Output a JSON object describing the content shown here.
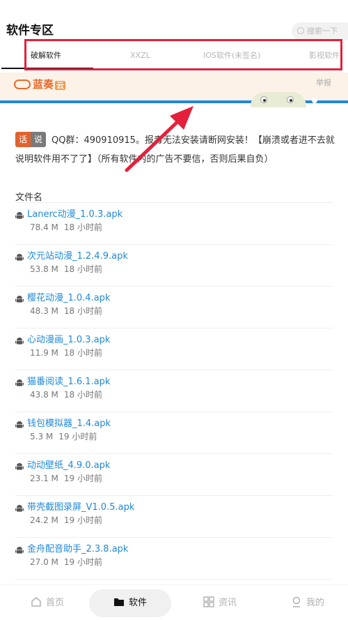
{
  "header": {
    "title": "软件专区",
    "search_placeholder": "搜索一下"
  },
  "tabs": [
    {
      "label": "破解软件",
      "active": true
    },
    {
      "label": "XXZL",
      "active": false
    },
    {
      "label": "IOS软件(未签名)",
      "active": false
    },
    {
      "label": "影视软件",
      "active": false
    }
  ],
  "banner": {
    "brand_text": "蓝奏",
    "brand_badge": "云",
    "report_label": "举报"
  },
  "notice": {
    "tag_left": "话",
    "tag_right": "说",
    "text": "QQ群：490910915。报毒无法安装请断网安装！【崩溃或者进不去就说明软件用不了了】（所有软件内的广告不要信，否则后果自负）"
  },
  "file_list": {
    "header": "文件名",
    "files": [
      {
        "name": "Lanerc动漫_1.0.3.apk",
        "size": "78.4 M",
        "time": "18 小时前"
      },
      {
        "name": "次元站动漫_1.2.4.9.apk",
        "size": "53.8 M",
        "time": "18 小时前"
      },
      {
        "name": "樱花动漫_1.0.4.apk",
        "size": "48.3 M",
        "time": "18 小时前"
      },
      {
        "name": "心动漫画_1.0.3.apk",
        "size": "11.9 M",
        "time": "18 小时前"
      },
      {
        "name": "猫番阅读_1.6.1.apk",
        "size": "43.8 M",
        "time": "18 小时前"
      },
      {
        "name": "钱包模拟器_1.4.apk",
        "size": "5.3 M",
        "time": "19 小时前"
      },
      {
        "name": "动动壁纸_4.9.0.apk",
        "size": "23.1 M",
        "time": "19 小时前"
      },
      {
        "name": "带壳截图录屏_V1.0.5.apk",
        "size": "24.2 M",
        "time": "19 小时前"
      },
      {
        "name": "金舟配音助手_2.3.8.apk",
        "size": "27.0 M",
        "time": "19 小时前"
      }
    ]
  },
  "bottom_nav": [
    {
      "label": "首页",
      "icon": "home-icon",
      "active": false
    },
    {
      "label": "软件",
      "icon": "folder-icon",
      "active": true
    },
    {
      "label": "资讯",
      "icon": "grid-icon",
      "active": false
    },
    {
      "label": "我的",
      "icon": "user-icon",
      "active": false
    }
  ],
  "colors": {
    "accent_link": "#1f88d9",
    "annotation_red": "#e4203a",
    "banner_bg": "#fdf2e7",
    "brand_orange": "#e86a2b"
  }
}
